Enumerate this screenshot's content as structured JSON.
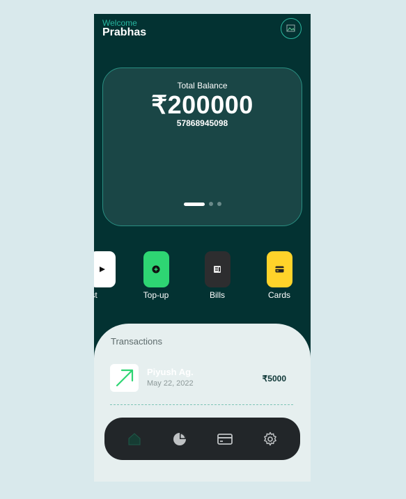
{
  "header": {
    "welcome": "Welcome",
    "username": "Prabhas"
  },
  "balance_card": {
    "label": "Total Balance",
    "amount": "₹200000",
    "account_number": "57868945098",
    "pages_total": 3,
    "page_active": 1
  },
  "actions": [
    {
      "label": "uest",
      "icon": "play-icon",
      "color": "#ffffff"
    },
    {
      "label": "Top-up",
      "icon": "plus-circle-icon",
      "color": "#2ed573"
    },
    {
      "label": "Bills",
      "icon": "receipt-icon",
      "color": "#2d2d2f"
    },
    {
      "label": "Cards",
      "icon": "card-icon",
      "color": "#ffd32a"
    }
  ],
  "transactions": {
    "title": "Transactions",
    "items": [
      {
        "name": "Piyush Ag.",
        "date": "May 22, 2022",
        "amount": "₹5000",
        "icon": "arrow-up-right-icon"
      }
    ]
  },
  "nav": [
    {
      "icon": "home-icon",
      "active": true
    },
    {
      "icon": "pie-chart-icon",
      "active": false
    },
    {
      "icon": "card-icon",
      "active": false
    },
    {
      "icon": "gear-icon",
      "active": false
    }
  ],
  "colors": {
    "background": "#d9e9ec",
    "phone_bg": "#033232",
    "accent": "#28b7a0",
    "card_bg": "#1a4646",
    "panel_bg": "#e6efef",
    "navbar_bg": "#222629"
  }
}
